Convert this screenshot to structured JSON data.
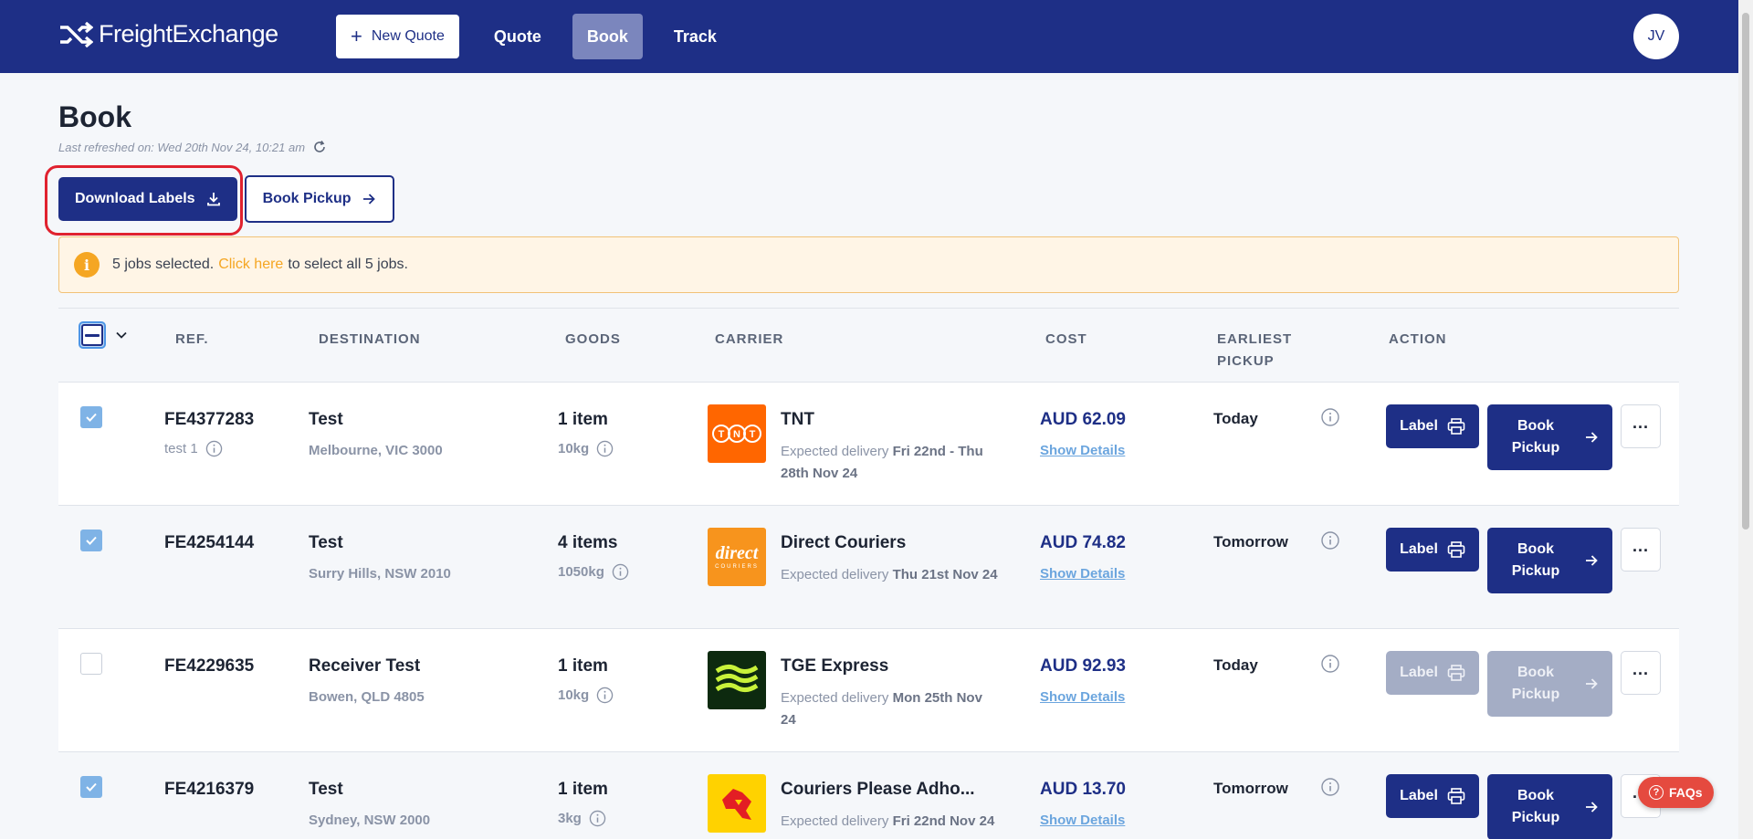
{
  "header": {
    "brand": "FreightExchange",
    "new_quote_label": "New Quote",
    "nav": [
      {
        "label": "Quote",
        "active": false
      },
      {
        "label": "Book",
        "active": true
      },
      {
        "label": "Track",
        "active": false
      }
    ],
    "avatar_initials": "JV"
  },
  "page": {
    "title": "Book",
    "last_refreshed": "Last refreshed on: Wed 20th Nov 24, 10:21 am",
    "download_labels": "Download Labels",
    "book_pickup": "Book Pickup"
  },
  "alert": {
    "text1": "5 jobs selected.",
    "link": "Click here",
    "text2": "to select all 5 jobs."
  },
  "table": {
    "columns": [
      "REF.",
      "DESTINATION",
      "GOODS",
      "CARRIER",
      "COST",
      "EARLIEST",
      "PICKUP",
      "ACTION"
    ],
    "rows": [
      {
        "checked": true,
        "ref": "FE4377283",
        "ref_sub": "test 1",
        "dest_name": "Test",
        "dest_addr": "Melbourne, VIC 3000",
        "goods": "1 item",
        "weight": "10kg",
        "carrier": "TNT",
        "eta_prefix": "Expected delivery",
        "eta": "Fri 22nd - Thu 28th Nov 24",
        "cost": "AUD 62.09",
        "show_details": "Show Details",
        "pickup": "Today",
        "label_btn": "Label",
        "book_btn": "Book Pickup",
        "disabled": false
      },
      {
        "checked": true,
        "ref": "FE4254144",
        "ref_sub": "",
        "dest_name": "Test",
        "dest_addr": "Surry Hills, NSW 2010",
        "goods": "4 items",
        "weight": "1050kg",
        "carrier": "Direct Couriers",
        "eta_prefix": "Expected delivery",
        "eta": "Thu 21st Nov 24",
        "cost": "AUD 74.82",
        "show_details": "Show Details",
        "pickup": "Tomorrow",
        "label_btn": "Label",
        "book_btn": "Book Pickup",
        "disabled": false
      },
      {
        "checked": false,
        "ref": "FE4229635",
        "ref_sub": "",
        "dest_name": "Receiver Test",
        "dest_addr": "Bowen, QLD 4805",
        "goods": "1 item",
        "weight": "10kg",
        "carrier": "TGE Express",
        "eta_prefix": "Expected delivery",
        "eta": "Mon 25th Nov 24",
        "cost": "AUD 92.93",
        "show_details": "Show Details",
        "pickup": "Today",
        "label_btn": "Label",
        "book_btn": "Book Pickup",
        "disabled": true
      },
      {
        "checked": true,
        "ref": "FE4216379",
        "ref_sub": "",
        "dest_name": "Test",
        "dest_addr": "Sydney, NSW 2000",
        "goods": "1 item",
        "weight": "3kg",
        "carrier": "Couriers Please Adho...",
        "eta_prefix": "Expected delivery",
        "eta": "Fri 22nd Nov 24",
        "cost": "AUD 13.70",
        "show_details": "Show Details",
        "pickup": "Tomorrow",
        "label_btn": "Label",
        "book_btn": "Book Pickup",
        "disabled": false
      }
    ]
  },
  "carrier_logos": {
    "tnt": {
      "bg": "#ff6600",
      "text": "TNT"
    },
    "direct": {
      "bg": "#f7941d",
      "text": "direct",
      "sub": "COURIERS"
    },
    "tge": {
      "bg": "#0d2a0f",
      "stripe": "#c8f23a"
    },
    "cp": {
      "bg": "#ffd200",
      "mark": "#e31e24"
    }
  },
  "faq_label": "FAQs",
  "colors": {
    "brand": "#1e2f86",
    "accent": "#f5a623",
    "link": "#6ba5de",
    "highlight": "#e0222f"
  }
}
